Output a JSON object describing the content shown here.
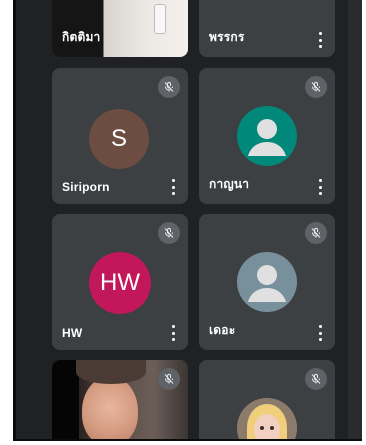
{
  "participants": [
    {
      "id": "p1",
      "name": "กิตติมา",
      "type": "video",
      "muted": false
    },
    {
      "id": "p2",
      "name": "พรรกร",
      "type": "cropped",
      "muted": false
    },
    {
      "id": "p3",
      "name": "Siriporn",
      "type": "letter",
      "initials": "S",
      "color": "#6d4c41",
      "muted": true
    },
    {
      "id": "p4",
      "name": "กาญนา",
      "type": "generic",
      "color": "#00897b",
      "muted": true
    },
    {
      "id": "p5",
      "name": "HW",
      "type": "letter",
      "initials": "HW",
      "color": "#c2185b",
      "muted": true
    },
    {
      "id": "p6",
      "name": "เดอะ",
      "type": "generic",
      "color": "#78909c",
      "muted": true
    },
    {
      "id": "p7",
      "name": "",
      "type": "video",
      "muted": true
    },
    {
      "id": "p8",
      "name": "",
      "type": "video",
      "muted": true
    }
  ],
  "icons": {
    "mic_off": "mic-off-icon",
    "more": "more-vert-icon",
    "person": "person-icon"
  }
}
